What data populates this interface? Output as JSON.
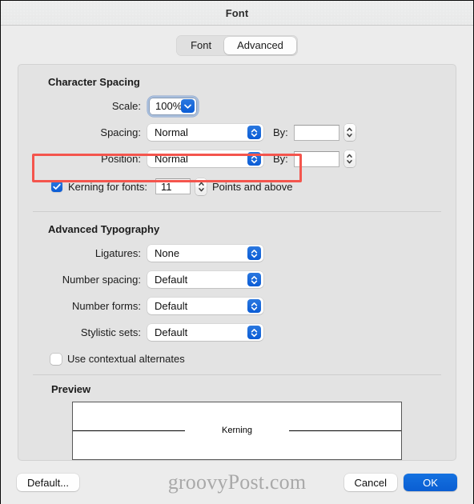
{
  "window": {
    "title": "Font"
  },
  "tabs": [
    {
      "label": "Font",
      "selected": false
    },
    {
      "label": "Advanced",
      "selected": true
    }
  ],
  "character_spacing": {
    "section_title": "Character Spacing",
    "scale": {
      "label": "Scale:",
      "value": "100%",
      "focused": true
    },
    "spacing": {
      "label": "Spacing:",
      "value": "Normal",
      "by_label": "By:",
      "by_value": ""
    },
    "position": {
      "label": "Position:",
      "value": "Normal",
      "by_label": "By:",
      "by_value": ""
    },
    "kerning": {
      "label": "Kerning for fonts:",
      "checked": true,
      "value": "11",
      "suffix": "Points and above",
      "highlight_color": "#f4554d"
    }
  },
  "advanced_typography": {
    "section_title": "Advanced Typography",
    "ligatures": {
      "label": "Ligatures:",
      "value": "None"
    },
    "number_spacing": {
      "label": "Number spacing:",
      "value": "Default"
    },
    "number_forms": {
      "label": "Number forms:",
      "value": "Default"
    },
    "stylistic_sets": {
      "label": "Stylistic sets:",
      "value": "Default"
    },
    "contextual_alternates": {
      "label": "Use contextual alternates",
      "checked": false
    }
  },
  "preview": {
    "title": "Preview",
    "sample_text": "Kerning"
  },
  "footer": {
    "default_label": "Default...",
    "cancel_label": "Cancel",
    "ok_label": "OK",
    "watermark": "groovyPost.com",
    "accent_color": "#0a5ed2"
  }
}
